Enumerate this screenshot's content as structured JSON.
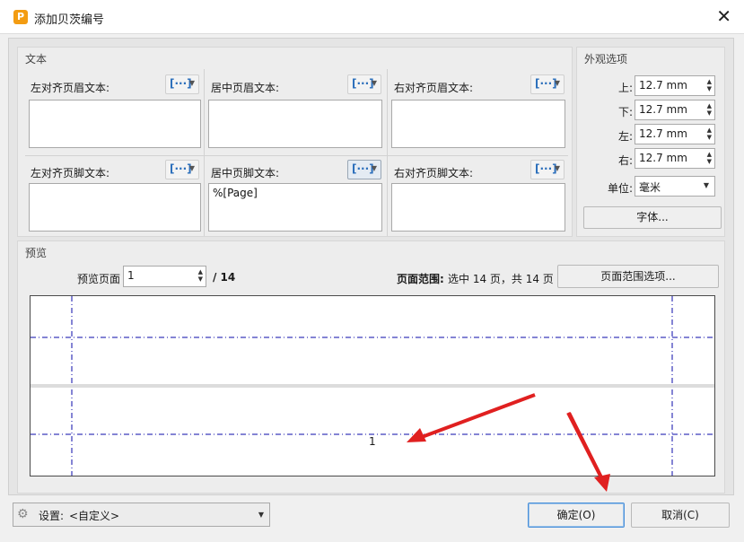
{
  "window": {
    "title": "添加贝茨编号",
    "app_icon_letter": "P"
  },
  "text_group": {
    "title": "文本",
    "header": {
      "left_label": "左对齐页眉文本:",
      "center_label": "居中页眉文本:",
      "right_label": "右对齐页眉文本:",
      "left_value": "",
      "center_value": "",
      "right_value": ""
    },
    "footer": {
      "left_label": "左对齐页脚文本:",
      "center_label": "居中页脚文本:",
      "right_label": "右对齐页脚文本:",
      "left_value": "",
      "center_value": "%[Page]",
      "right_value": ""
    },
    "macro_button_glyph": "[···]"
  },
  "appearance_group": {
    "title": "外观选项",
    "top_label": "上:",
    "top_value": "12.7 mm",
    "bottom_label": "下:",
    "bottom_value": "12.7 mm",
    "left_label": "左:",
    "left_value": "12.7 mm",
    "right_label": "右:",
    "right_value": "12.7 mm",
    "unit_label": "单位:",
    "unit_value": "毫米",
    "font_button": "字体..."
  },
  "preview_group": {
    "title": "预览",
    "preview_page_label": "预览页面",
    "preview_page_value": "1",
    "page_total": "/ 14",
    "page_range_label": "页面范围:",
    "page_range_text": "选中 14 页，共 14 页",
    "page_range_button": "页面范围选项...",
    "canvas_page_number": "1",
    "guide_color": "#0a0aa8",
    "arrow_color": "#e02020"
  },
  "bottom": {
    "settings_label": "设置:",
    "settings_value": "<自定义>",
    "ok_button": "确定(O)",
    "cancel_button": "取消(C)"
  }
}
